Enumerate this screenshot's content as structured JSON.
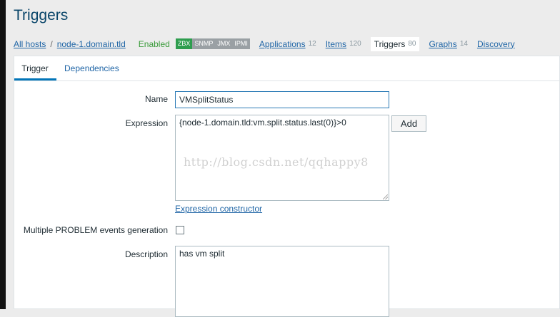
{
  "page": {
    "title": "Triggers"
  },
  "breadcrumb": {
    "all_hosts": "All hosts",
    "separator": "/",
    "host": "node-1.domain.tld",
    "status": "Enabled",
    "availability": [
      "ZBX",
      "SNMP",
      "JMX",
      "IPMI"
    ],
    "tabs": [
      {
        "label": "Applications",
        "count": "12"
      },
      {
        "label": "Items",
        "count": "120"
      },
      {
        "label": "Triggers",
        "count": "80"
      },
      {
        "label": "Graphs",
        "count": "14"
      },
      {
        "label": "Discovery",
        "count": ""
      }
    ]
  },
  "form": {
    "tabs": {
      "trigger": "Trigger",
      "dependencies": "Dependencies"
    },
    "name_label": "Name",
    "name_value": "VMSplitStatus",
    "expression_label": "Expression",
    "expression_value": "{node-1.domain.tld:vm.split.status.last(0)}>0",
    "add_button": "Add",
    "expression_constructor": "Expression constructor",
    "multiple_events_label": "Multiple PROBLEM events generation",
    "description_label": "Description",
    "description_value": "has vm split"
  },
  "watermark": "http://blog.csdn.net/qqhappy8",
  "colors": {
    "accent": "#0275b8",
    "link": "#1f65a6",
    "enabled": "#3a9b3a",
    "zbx": "#2e9d4e"
  }
}
